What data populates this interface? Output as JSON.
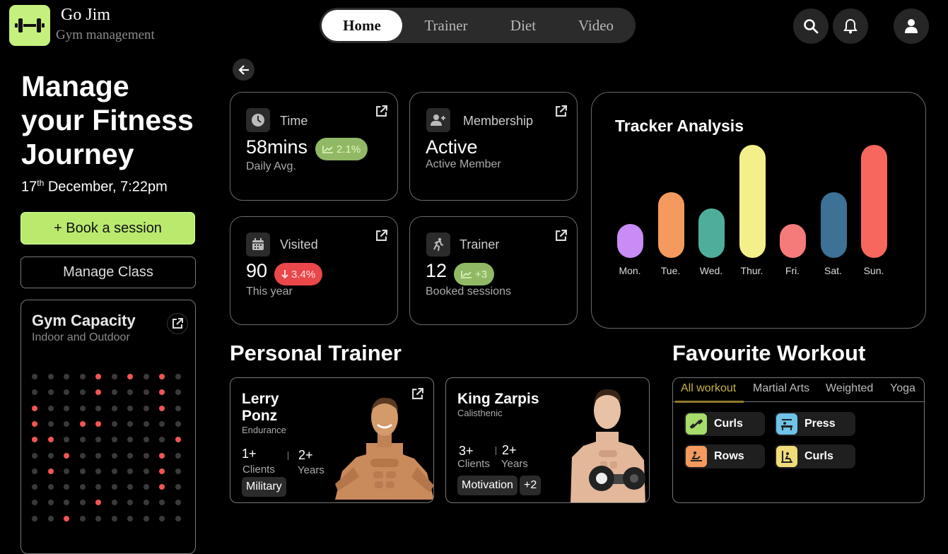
{
  "app": {
    "title": "Go Jim",
    "subtitle": "Gym management"
  },
  "nav": {
    "tabs": [
      {
        "label": "Home",
        "active": true
      },
      {
        "label": "Trainer",
        "active": false
      },
      {
        "label": "Diet",
        "active": false
      },
      {
        "label": "Video",
        "active": false
      }
    ]
  },
  "header_icons": [
    "search-icon",
    "bell-icon",
    "user-icon"
  ],
  "hero": {
    "title_line1": "Manage",
    "title_line2": "your Fitness",
    "title_line3": "Journey",
    "date_day": "17",
    "date_suffix": "th",
    "date_rest": " December, 7:22pm",
    "book_label": "+ Book a session",
    "manage_label": "Manage Class"
  },
  "capacity": {
    "title": "Gym Capacity",
    "subtitle": "Indoor and Outdoor",
    "grid": [
      "0000101010",
      "0000100010",
      "1000000010",
      "1001100000",
      "1100000001",
      "0010000010",
      "0100000010",
      "0000000010",
      "0000100000",
      "0010000000"
    ]
  },
  "stats": {
    "time": {
      "label": "Time",
      "value": "58mins",
      "badge": "2.1%",
      "sub": "Daily Avg."
    },
    "membership": {
      "label": "Membership",
      "value": "Active",
      "sub": "Active Member"
    },
    "visited": {
      "label": "Visited",
      "value": "90",
      "badge": "3.4%",
      "sub": "This year"
    },
    "trainer": {
      "label": "Trainer",
      "value": "12",
      "badge": "+3",
      "sub": "Booked sessions"
    }
  },
  "tracker": {
    "title": "Tracker Analysis",
    "days": [
      {
        "label": "Mon.",
        "level": 0.5,
        "color": "#c98cf7"
      },
      {
        "label": "Tue.",
        "level": 0.7,
        "color": "#f49a5e"
      },
      {
        "label": "Wed.",
        "level": 0.6,
        "color": "#4fae9b"
      },
      {
        "label": "Thur.",
        "level": 1.0,
        "color": "#f3ef8a"
      },
      {
        "label": "Fri.",
        "level": 0.5,
        "color": "#f57a7a"
      },
      {
        "label": "Sat.",
        "level": 0.7,
        "color": "#3d7196"
      },
      {
        "label": "Sun.",
        "level": 1.0,
        "color": "#f7675d"
      }
    ]
  },
  "personal_trainer": {
    "title": "Personal Trainer",
    "trainers": [
      {
        "name_line1": "Lerry",
        "name_line2": "Ponz",
        "role": "Endurance",
        "clients": "1+",
        "clients_label": "Clients",
        "years": "2+",
        "years_label": "Years",
        "tags": [
          "Military"
        ]
      },
      {
        "name_line1": "King Zarpis",
        "role": "Calisthenic",
        "clients": "3+",
        "clients_label": "Clients",
        "years": "2+",
        "years_label": "Years",
        "tags": [
          "Motivation",
          "+2"
        ]
      }
    ]
  },
  "favourite_workout": {
    "title": "Favourite Workout",
    "tabs": [
      "All workout",
      "Martial Arts",
      "Weighted",
      "Yoga"
    ],
    "active_tab": "All workout",
    "items": [
      {
        "label": "Curls",
        "icon": "dumbbell-icon",
        "color": "#a8dc6a"
      },
      {
        "label": "Press",
        "icon": "bench-press-icon",
        "color": "#6fc3e8"
      },
      {
        "label": "Rows",
        "icon": "rowing-icon",
        "color": "#f49a5e"
      },
      {
        "label": "Curls",
        "icon": "curl-machine-icon",
        "color": "#f0dd7a"
      }
    ]
  }
}
